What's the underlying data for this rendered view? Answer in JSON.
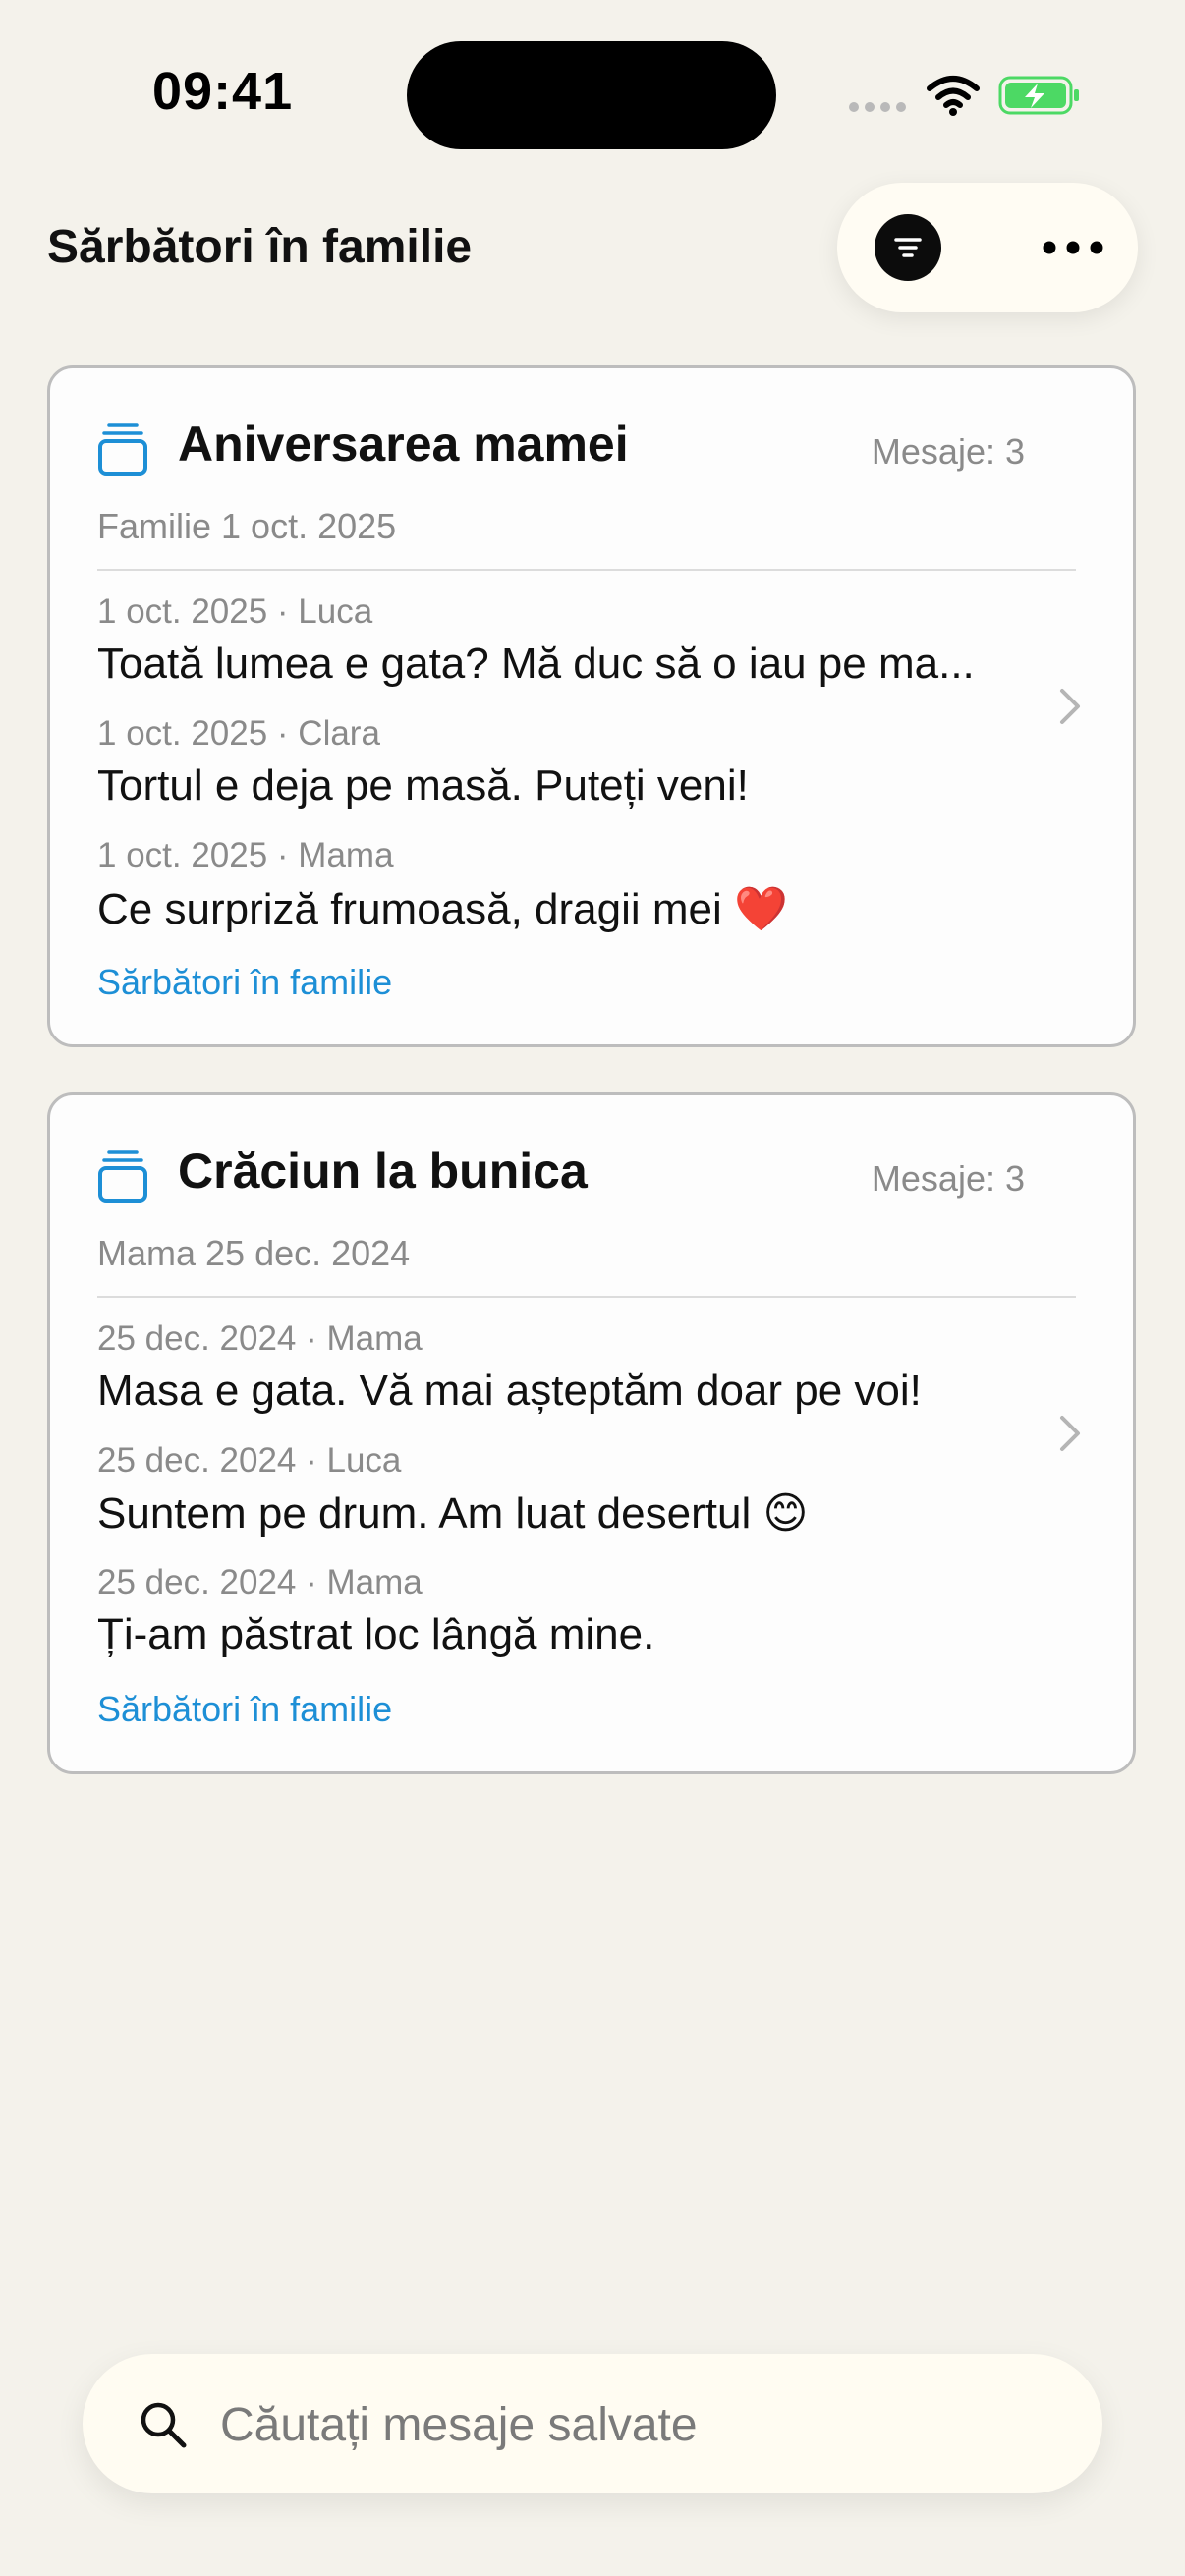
{
  "status_bar": {
    "time": "09:41",
    "icons": [
      "cellular-signal-icon",
      "wifi-icon",
      "battery-charging-icon"
    ]
  },
  "header": {
    "title": "Sărbători în familie",
    "actions": [
      {
        "name": "filter",
        "icon": "filter-icon"
      },
      {
        "name": "more",
        "icon": "more-horizontal-icon"
      }
    ]
  },
  "conversations": [
    {
      "title": "Aniversarea mamei",
      "count": "Mesaje: 3",
      "meta": "Familie  1 oct. 2025",
      "messages": [
        {
          "meta": "1 oct. 2025 · Luca",
          "text": "Toată lumea e gata? Mă duc să o iau pe ma..."
        },
        {
          "meta": "1 oct. 2025 · Clara",
          "text": "Tortul e deja pe masă. Puteți veni!"
        },
        {
          "meta": "1 oct. 2025 · Mama",
          "text": "Ce surpriză frumoasă, dragii mei ❤️"
        }
      ],
      "link": "Sărbători în familie"
    },
    {
      "title": "Crăciun la bunica",
      "count": "Mesaje: 3",
      "meta": "Mama  25 dec. 2024",
      "messages": [
        {
          "meta": "25 dec. 2024 · Mama",
          "text": "Masa e gata. Vă mai așteptăm doar pe voi!"
        },
        {
          "meta": "25 dec. 2024 · Luca",
          "text": "Suntem pe drum. Am luat desertul 😊"
        },
        {
          "meta": "25 dec. 2024 · Mama",
          "text": "Ți-am păstrat loc lângă mine."
        }
      ],
      "link": "Sărbători în familie"
    }
  ],
  "search": {
    "placeholder": "Căutați mesaje salvate",
    "value": ""
  },
  "colors": {
    "background": "#f4f2eb",
    "accent": "#1d8fd6",
    "battery": "#4cd964"
  }
}
